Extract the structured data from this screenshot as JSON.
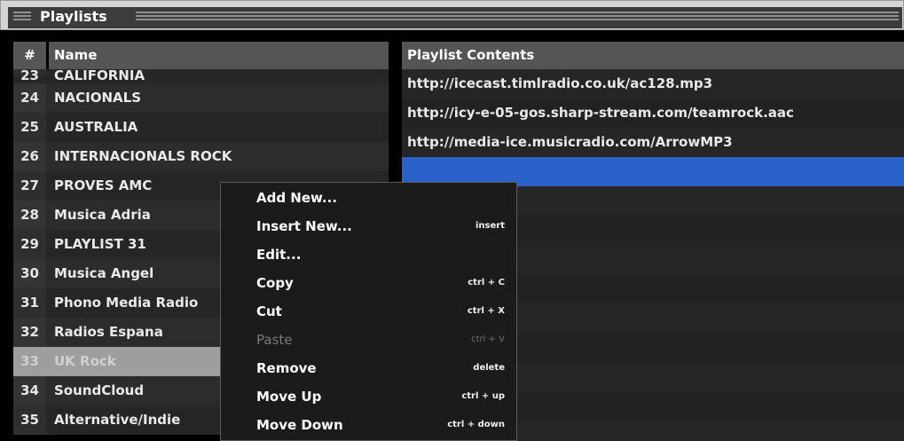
{
  "panel": {
    "title": "Playlists"
  },
  "columns": {
    "num": "#",
    "name": "Name",
    "contents": "Playlist Contents"
  },
  "playlists": [
    {
      "num": "23",
      "name": "CALIFORNIA"
    },
    {
      "num": "24",
      "name": "NACIONALS"
    },
    {
      "num": "25",
      "name": "AUSTRALIA"
    },
    {
      "num": "26",
      "name": "INTERNACIONALS ROCK"
    },
    {
      "num": "27",
      "name": "PROVES AMC"
    },
    {
      "num": "28",
      "name": "Musica Adria"
    },
    {
      "num": "29",
      "name": "PLAYLIST 31"
    },
    {
      "num": "30",
      "name": "Musica Angel"
    },
    {
      "num": "31",
      "name": "Phono Media Radio"
    },
    {
      "num": "32",
      "name": "Radios Espana"
    },
    {
      "num": "33",
      "name": "UK Rock",
      "selected": true
    },
    {
      "num": "34",
      "name": "SoundCloud"
    },
    {
      "num": "35",
      "name": "Alternative/Indie"
    }
  ],
  "contents": [
    {
      "url": "http://icecast.timlradio.co.uk/ac128.mp3"
    },
    {
      "url": "http://icy-e-05-gos.sharp-stream.com/teamrock.aac"
    },
    {
      "url": "http://media-ice.musicradio.com/ArrowMP3"
    },
    {
      "url": "",
      "selected": true
    }
  ],
  "context_menu": {
    "items": [
      {
        "label": "Add New...",
        "shortcut": ""
      },
      {
        "label": "Insert New...",
        "shortcut": "insert"
      },
      {
        "label": "Edit...",
        "shortcut": ""
      },
      {
        "label": "Copy",
        "shortcut": "ctrl + C"
      },
      {
        "label": "Cut",
        "shortcut": "ctrl + X"
      },
      {
        "label": "Paste",
        "shortcut": "ctrl + V",
        "disabled": true
      },
      {
        "label": "Remove",
        "shortcut": "delete"
      },
      {
        "label": "Move Up",
        "shortcut": "ctrl + up"
      },
      {
        "label": "Move Down",
        "shortcut": "ctrl + down"
      }
    ]
  },
  "colors": {
    "selection": "#2a62c9",
    "selected_row": "#9e9e9e"
  }
}
